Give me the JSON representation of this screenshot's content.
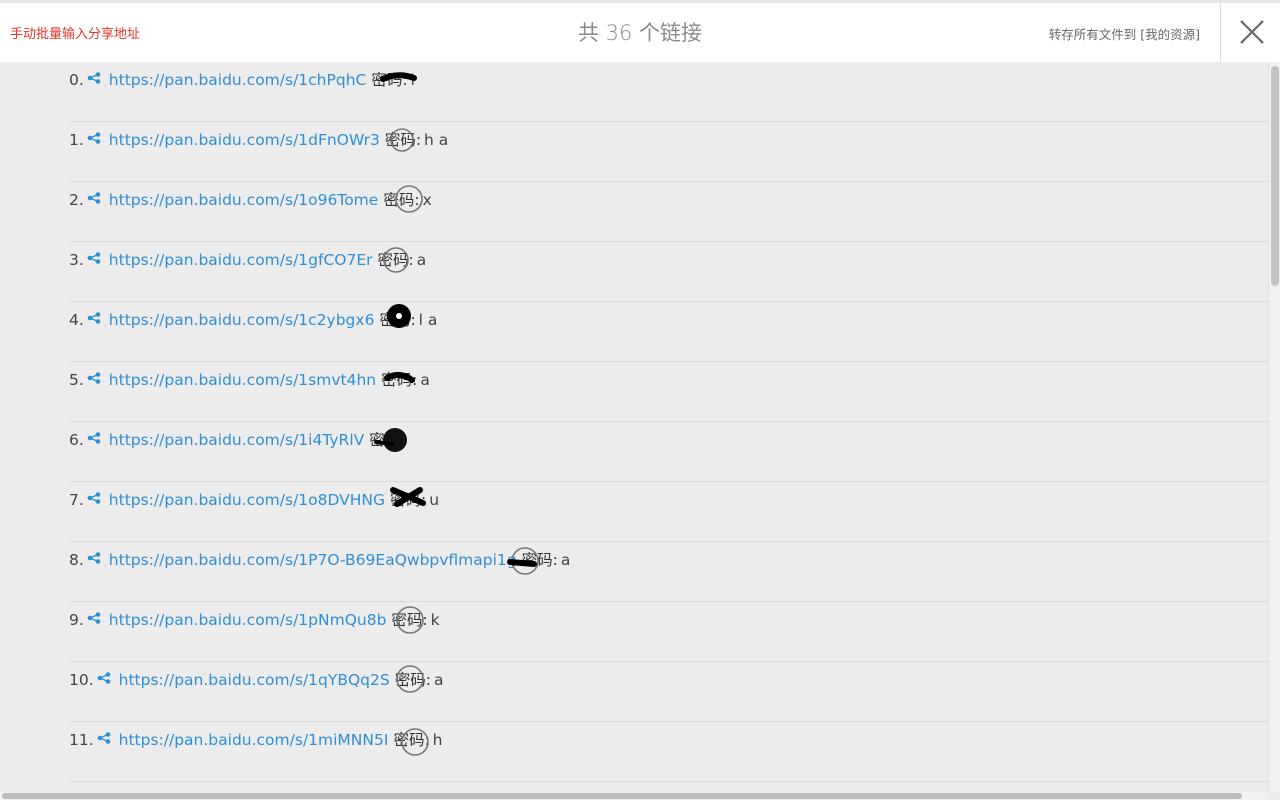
{
  "header": {
    "manual_input_label": "手动批量输入分享地址",
    "title": "共 36 个链接",
    "save_all_label": "转存所有文件到 [我的资源]",
    "close_icon": "close-icon"
  },
  "links": [
    {
      "index": "0.",
      "url": "https://pan.baidu.com/s/1chPqhC",
      "pwd_label": "密码:",
      "pwd": "l"
    },
    {
      "index": "1.",
      "url": "https://pan.baidu.com/s/1dFnOWr3",
      "pwd_label": "密码:",
      "pwd": "h a"
    },
    {
      "index": "2.",
      "url": "https://pan.baidu.com/s/1o96Tome",
      "pwd_label": "密码:",
      "pwd": "x"
    },
    {
      "index": "3.",
      "url": "https://pan.baidu.com/s/1gfCO7Er",
      "pwd_label": "密码:",
      "pwd": "a"
    },
    {
      "index": "4.",
      "url": "https://pan.baidu.com/s/1c2ybgx6",
      "pwd_label": "密码:",
      "pwd": "l a"
    },
    {
      "index": "5.",
      "url": "https://pan.baidu.com/s/1smvt4hn",
      "pwd_label": "密码:",
      "pwd": "a"
    },
    {
      "index": "6.",
      "url": "https://pan.baidu.com/s/1i4TyRlV",
      "pwd_label": "密码:",
      "pwd": ""
    },
    {
      "index": "7.",
      "url": "https://pan.baidu.com/s/1o8DVHNG",
      "pwd_label": "密码:",
      "pwd": "u"
    },
    {
      "index": "8.",
      "url": "https://pan.baidu.com/s/1P7O-B69EaQwbpvflmapi1g",
      "pwd_label": "密码:",
      "pwd": "a"
    },
    {
      "index": "9.",
      "url": "https://pan.baidu.com/s/1pNmQu8b",
      "pwd_label": "密码:",
      "pwd": "k"
    },
    {
      "index": "10.",
      "url": "https://pan.baidu.com/s/1qYBQq2S",
      "pwd_label": "密码:",
      "pwd": "a"
    },
    {
      "index": "11.",
      "url": "https://pan.baidu.com/s/1miMNN5I",
      "pwd_label": "密码:",
      "pwd": "h"
    }
  ],
  "colors": {
    "link": "#2f8fd6",
    "accent_red": "#e0352b",
    "background": "#ececec"
  },
  "icons": {
    "row_icon": "share-icon"
  }
}
